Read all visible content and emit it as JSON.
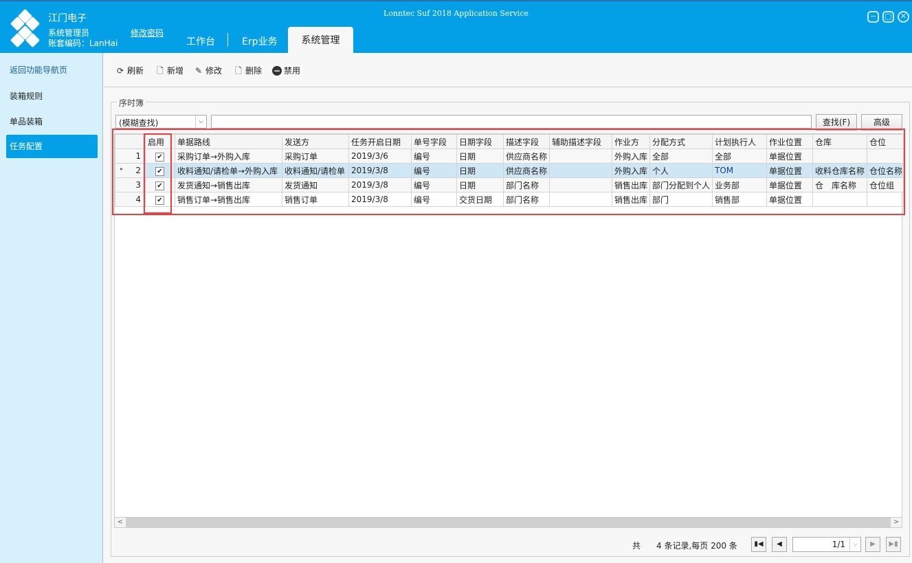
{
  "window": {
    "title": "Lonntec Suf 2018 Application Service"
  },
  "header": {
    "company": "江门电子",
    "user": "系统管理员",
    "account": "账套编码：LanHai",
    "change_password": "修改密码",
    "tabs": [
      "工作台",
      "Erp业务",
      "系统管理"
    ]
  },
  "sidebar": {
    "items": [
      "返回功能导航页",
      "装箱规则",
      "单品装箱",
      "任务配置"
    ],
    "active": 3
  },
  "toolbar": {
    "refresh": "刷新",
    "add": "新增",
    "edit": "修改",
    "delete": "删除",
    "disable": "禁用"
  },
  "group": {
    "title": "序时簿"
  },
  "search": {
    "mode": "(模糊查找)",
    "value": "",
    "find": "查找(F)",
    "advanced": "高级"
  },
  "grid": {
    "columns": [
      "启用",
      "单据路线",
      "发送方",
      "任务开启日期",
      "单号字段",
      "日期字段",
      "描述字段",
      "辅助描述字段",
      "作业方",
      "分配方式",
      "计划执行人",
      "作业位置",
      "仓库",
      "仓位"
    ],
    "rows": [
      [
        "1",
        true,
        "采购订单→外购入库",
        "采购订单",
        "2019/3/6",
        "编号",
        "日期",
        "供应商名称",
        "",
        "外购入库",
        "全部",
        "全部",
        "单据位置",
        "",
        ""
      ],
      [
        "2",
        true,
        "收料通知/请检单→外购入库",
        "收料通知/请检单",
        "2019/3/8",
        "编号",
        "日期",
        "供应商名称",
        "",
        "外购入库",
        "个人",
        "TOM",
        "单据位置",
        "收料仓库名称",
        "仓位名称"
      ],
      [
        "3",
        true,
        "发货通知→销售出库",
        "发货通知",
        "2019/3/8",
        "编号",
        "日期",
        "部门名称",
        "",
        "销售出库",
        "部门分配到个人",
        "业务部",
        "单据位置",
        "仓　库名称",
        "仓位组"
      ],
      [
        "4",
        true,
        "销售订单→销售出库",
        "销售订单",
        "2019/3/8",
        "编号",
        "交货日期",
        "部门名称",
        "",
        "销售出库",
        "部门",
        "销售部",
        "单据位置",
        "",
        ""
      ]
    ],
    "selected_row": 2
  },
  "pager": {
    "total_prefix": "共",
    "summary": "4 条记录,每页 200 条",
    "page": "1/1"
  }
}
